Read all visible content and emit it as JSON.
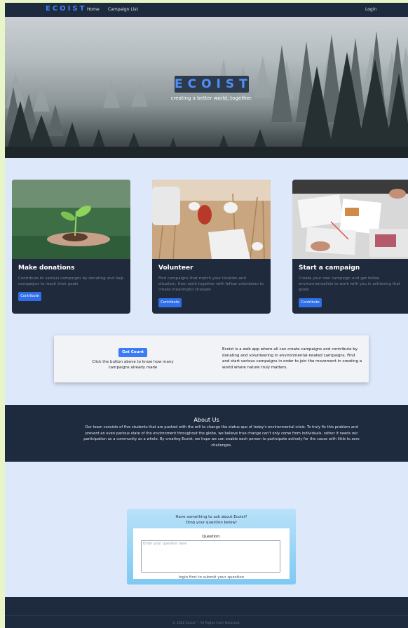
{
  "nav": {
    "brand": "ECOIST",
    "links": [
      "Home",
      "Campaign List"
    ],
    "login": "Login"
  },
  "hero": {
    "title": "ECOIST",
    "subtitle": "creating a better world, together."
  },
  "cards": [
    {
      "title": "Make donations",
      "text": "Contribute to various campaigns by donating and help campaigns to reach their goals",
      "button": "Contribute",
      "image": "hand-holding-sprout"
    },
    {
      "title": "Volunteer",
      "text": "Find campaigns that match your location and situation, then work together with fellow volunteers to create meaningful changes",
      "button": "Contribute",
      "image": "picking-up-litter"
    },
    {
      "title": "Start a campaign",
      "text": "Create your own campaign and get fellow environmentalists to work with you in achieving that goals",
      "button": "Contribute",
      "image": "planning-on-papers"
    }
  ],
  "count": {
    "button": "Get Count",
    "hint": "Click the button above to know how many campaigns already made",
    "description": "Ecoist is a web app where all can create campaigns and contribute by donating and volunteering in environmental-related campaigns. Find and start various campaigns in order to join the movement in creating a world where nature truly matters."
  },
  "about": {
    "title": "About Us",
    "text": "Our team consists of five students that are pushed with the will to change the status quo of today's environmental crisis. To truly fix this problem and prevent an even parlous state of the environment throughout the globe, we believe true change can't only come from individuals, rather it needs our participation as a community as a whole. By creating Ecoist, we hope we can enable each person to participate actively for the cause with little to zero challenges."
  },
  "question": {
    "heading_line1": "Have something to ask about Ecoist?",
    "heading_line2": "Drop your question below!",
    "label": "Question:",
    "placeholder": "Enter your question here",
    "note": "login first to submit your question"
  },
  "footer": {
    "text": "© 2022 Ecoist™. All Rights (not) Reserved."
  },
  "colors": {
    "nav_bg": "#1e2a3e",
    "accent": "#3f83f8",
    "page_bg": "#dde8fb",
    "card_bg": "#1f2a3c"
  }
}
